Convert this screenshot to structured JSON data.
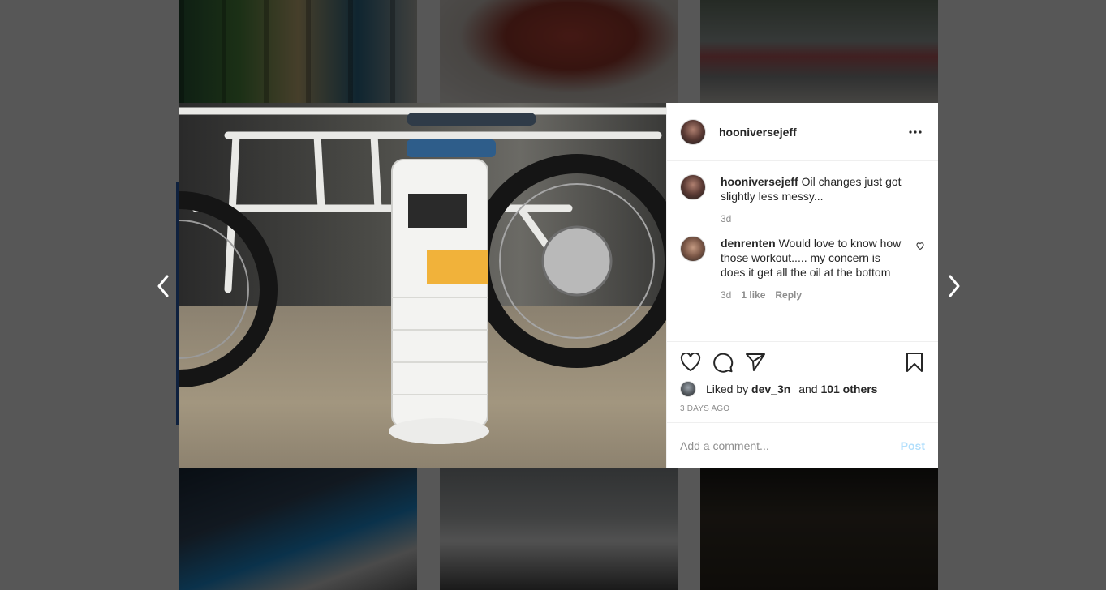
{
  "post": {
    "author": "hooniversejeff",
    "caption": "Oil changes just got slightly less messy...",
    "caption_time": "3d",
    "liked_by_prefix": "Liked by",
    "liked_by_user": "dev_3n",
    "liked_by_joiner": "and",
    "liked_by_others": "101 others",
    "time_ago": "3 days ago"
  },
  "comments": [
    {
      "user": "denrenten",
      "text": "Would love to know how those workout..... my concern is does it get all the oil at the bottom",
      "time": "3d",
      "likes": "1 like",
      "reply_label": "Reply"
    }
  ],
  "add_comment": {
    "placeholder": "Add a comment...",
    "post_label": "Post"
  },
  "colors": {
    "overlay": "#000000",
    "post_button_disabled": "#b2dffc",
    "muted_text": "#8e8e8e",
    "primary_text": "#262626"
  },
  "icons": {
    "prev": "chevron-left-icon",
    "next": "chevron-right-icon",
    "more": "more-horizontal-icon",
    "like": "heart-icon",
    "comment": "comment-icon",
    "share": "paper-plane-icon",
    "save": "bookmark-icon"
  }
}
